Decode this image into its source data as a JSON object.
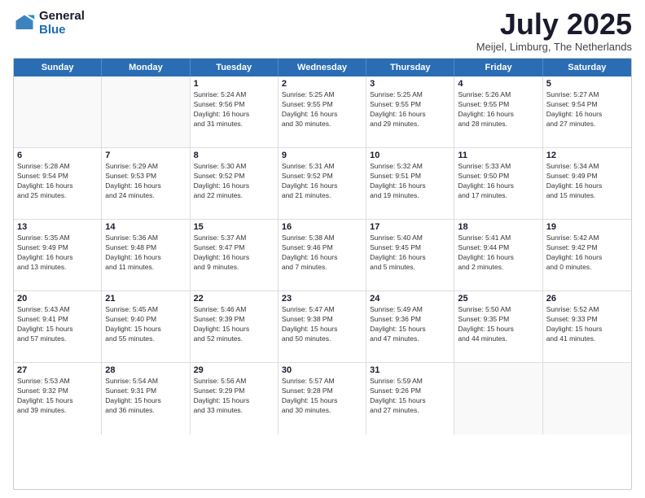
{
  "logo": {
    "general": "General",
    "blue": "Blue"
  },
  "title": "July 2025",
  "subtitle": "Meijel, Limburg, The Netherlands",
  "header_days": [
    "Sunday",
    "Monday",
    "Tuesday",
    "Wednesday",
    "Thursday",
    "Friday",
    "Saturday"
  ],
  "weeks": [
    [
      {
        "day": "",
        "info": ""
      },
      {
        "day": "",
        "info": ""
      },
      {
        "day": "1",
        "info": "Sunrise: 5:24 AM\nSunset: 9:56 PM\nDaylight: 16 hours\nand 31 minutes."
      },
      {
        "day": "2",
        "info": "Sunrise: 5:25 AM\nSunset: 9:55 PM\nDaylight: 16 hours\nand 30 minutes."
      },
      {
        "day": "3",
        "info": "Sunrise: 5:25 AM\nSunset: 9:55 PM\nDaylight: 16 hours\nand 29 minutes."
      },
      {
        "day": "4",
        "info": "Sunrise: 5:26 AM\nSunset: 9:55 PM\nDaylight: 16 hours\nand 28 minutes."
      },
      {
        "day": "5",
        "info": "Sunrise: 5:27 AM\nSunset: 9:54 PM\nDaylight: 16 hours\nand 27 minutes."
      }
    ],
    [
      {
        "day": "6",
        "info": "Sunrise: 5:28 AM\nSunset: 9:54 PM\nDaylight: 16 hours\nand 25 minutes."
      },
      {
        "day": "7",
        "info": "Sunrise: 5:29 AM\nSunset: 9:53 PM\nDaylight: 16 hours\nand 24 minutes."
      },
      {
        "day": "8",
        "info": "Sunrise: 5:30 AM\nSunset: 9:52 PM\nDaylight: 16 hours\nand 22 minutes."
      },
      {
        "day": "9",
        "info": "Sunrise: 5:31 AM\nSunset: 9:52 PM\nDaylight: 16 hours\nand 21 minutes."
      },
      {
        "day": "10",
        "info": "Sunrise: 5:32 AM\nSunset: 9:51 PM\nDaylight: 16 hours\nand 19 minutes."
      },
      {
        "day": "11",
        "info": "Sunrise: 5:33 AM\nSunset: 9:50 PM\nDaylight: 16 hours\nand 17 minutes."
      },
      {
        "day": "12",
        "info": "Sunrise: 5:34 AM\nSunset: 9:49 PM\nDaylight: 16 hours\nand 15 minutes."
      }
    ],
    [
      {
        "day": "13",
        "info": "Sunrise: 5:35 AM\nSunset: 9:49 PM\nDaylight: 16 hours\nand 13 minutes."
      },
      {
        "day": "14",
        "info": "Sunrise: 5:36 AM\nSunset: 9:48 PM\nDaylight: 16 hours\nand 11 minutes."
      },
      {
        "day": "15",
        "info": "Sunrise: 5:37 AM\nSunset: 9:47 PM\nDaylight: 16 hours\nand 9 minutes."
      },
      {
        "day": "16",
        "info": "Sunrise: 5:38 AM\nSunset: 9:46 PM\nDaylight: 16 hours\nand 7 minutes."
      },
      {
        "day": "17",
        "info": "Sunrise: 5:40 AM\nSunset: 9:45 PM\nDaylight: 16 hours\nand 5 minutes."
      },
      {
        "day": "18",
        "info": "Sunrise: 5:41 AM\nSunset: 9:44 PM\nDaylight: 16 hours\nand 2 minutes."
      },
      {
        "day": "19",
        "info": "Sunrise: 5:42 AM\nSunset: 9:42 PM\nDaylight: 16 hours\nand 0 minutes."
      }
    ],
    [
      {
        "day": "20",
        "info": "Sunrise: 5:43 AM\nSunset: 9:41 PM\nDaylight: 15 hours\nand 57 minutes."
      },
      {
        "day": "21",
        "info": "Sunrise: 5:45 AM\nSunset: 9:40 PM\nDaylight: 15 hours\nand 55 minutes."
      },
      {
        "day": "22",
        "info": "Sunrise: 5:46 AM\nSunset: 9:39 PM\nDaylight: 15 hours\nand 52 minutes."
      },
      {
        "day": "23",
        "info": "Sunrise: 5:47 AM\nSunset: 9:38 PM\nDaylight: 15 hours\nand 50 minutes."
      },
      {
        "day": "24",
        "info": "Sunrise: 5:49 AM\nSunset: 9:36 PM\nDaylight: 15 hours\nand 47 minutes."
      },
      {
        "day": "25",
        "info": "Sunrise: 5:50 AM\nSunset: 9:35 PM\nDaylight: 15 hours\nand 44 minutes."
      },
      {
        "day": "26",
        "info": "Sunrise: 5:52 AM\nSunset: 9:33 PM\nDaylight: 15 hours\nand 41 minutes."
      }
    ],
    [
      {
        "day": "27",
        "info": "Sunrise: 5:53 AM\nSunset: 9:32 PM\nDaylight: 15 hours\nand 39 minutes."
      },
      {
        "day": "28",
        "info": "Sunrise: 5:54 AM\nSunset: 9:31 PM\nDaylight: 15 hours\nand 36 minutes."
      },
      {
        "day": "29",
        "info": "Sunrise: 5:56 AM\nSunset: 9:29 PM\nDaylight: 15 hours\nand 33 minutes."
      },
      {
        "day": "30",
        "info": "Sunrise: 5:57 AM\nSunset: 9:28 PM\nDaylight: 15 hours\nand 30 minutes."
      },
      {
        "day": "31",
        "info": "Sunrise: 5:59 AM\nSunset: 9:26 PM\nDaylight: 15 hours\nand 27 minutes."
      },
      {
        "day": "",
        "info": ""
      },
      {
        "day": "",
        "info": ""
      }
    ]
  ]
}
